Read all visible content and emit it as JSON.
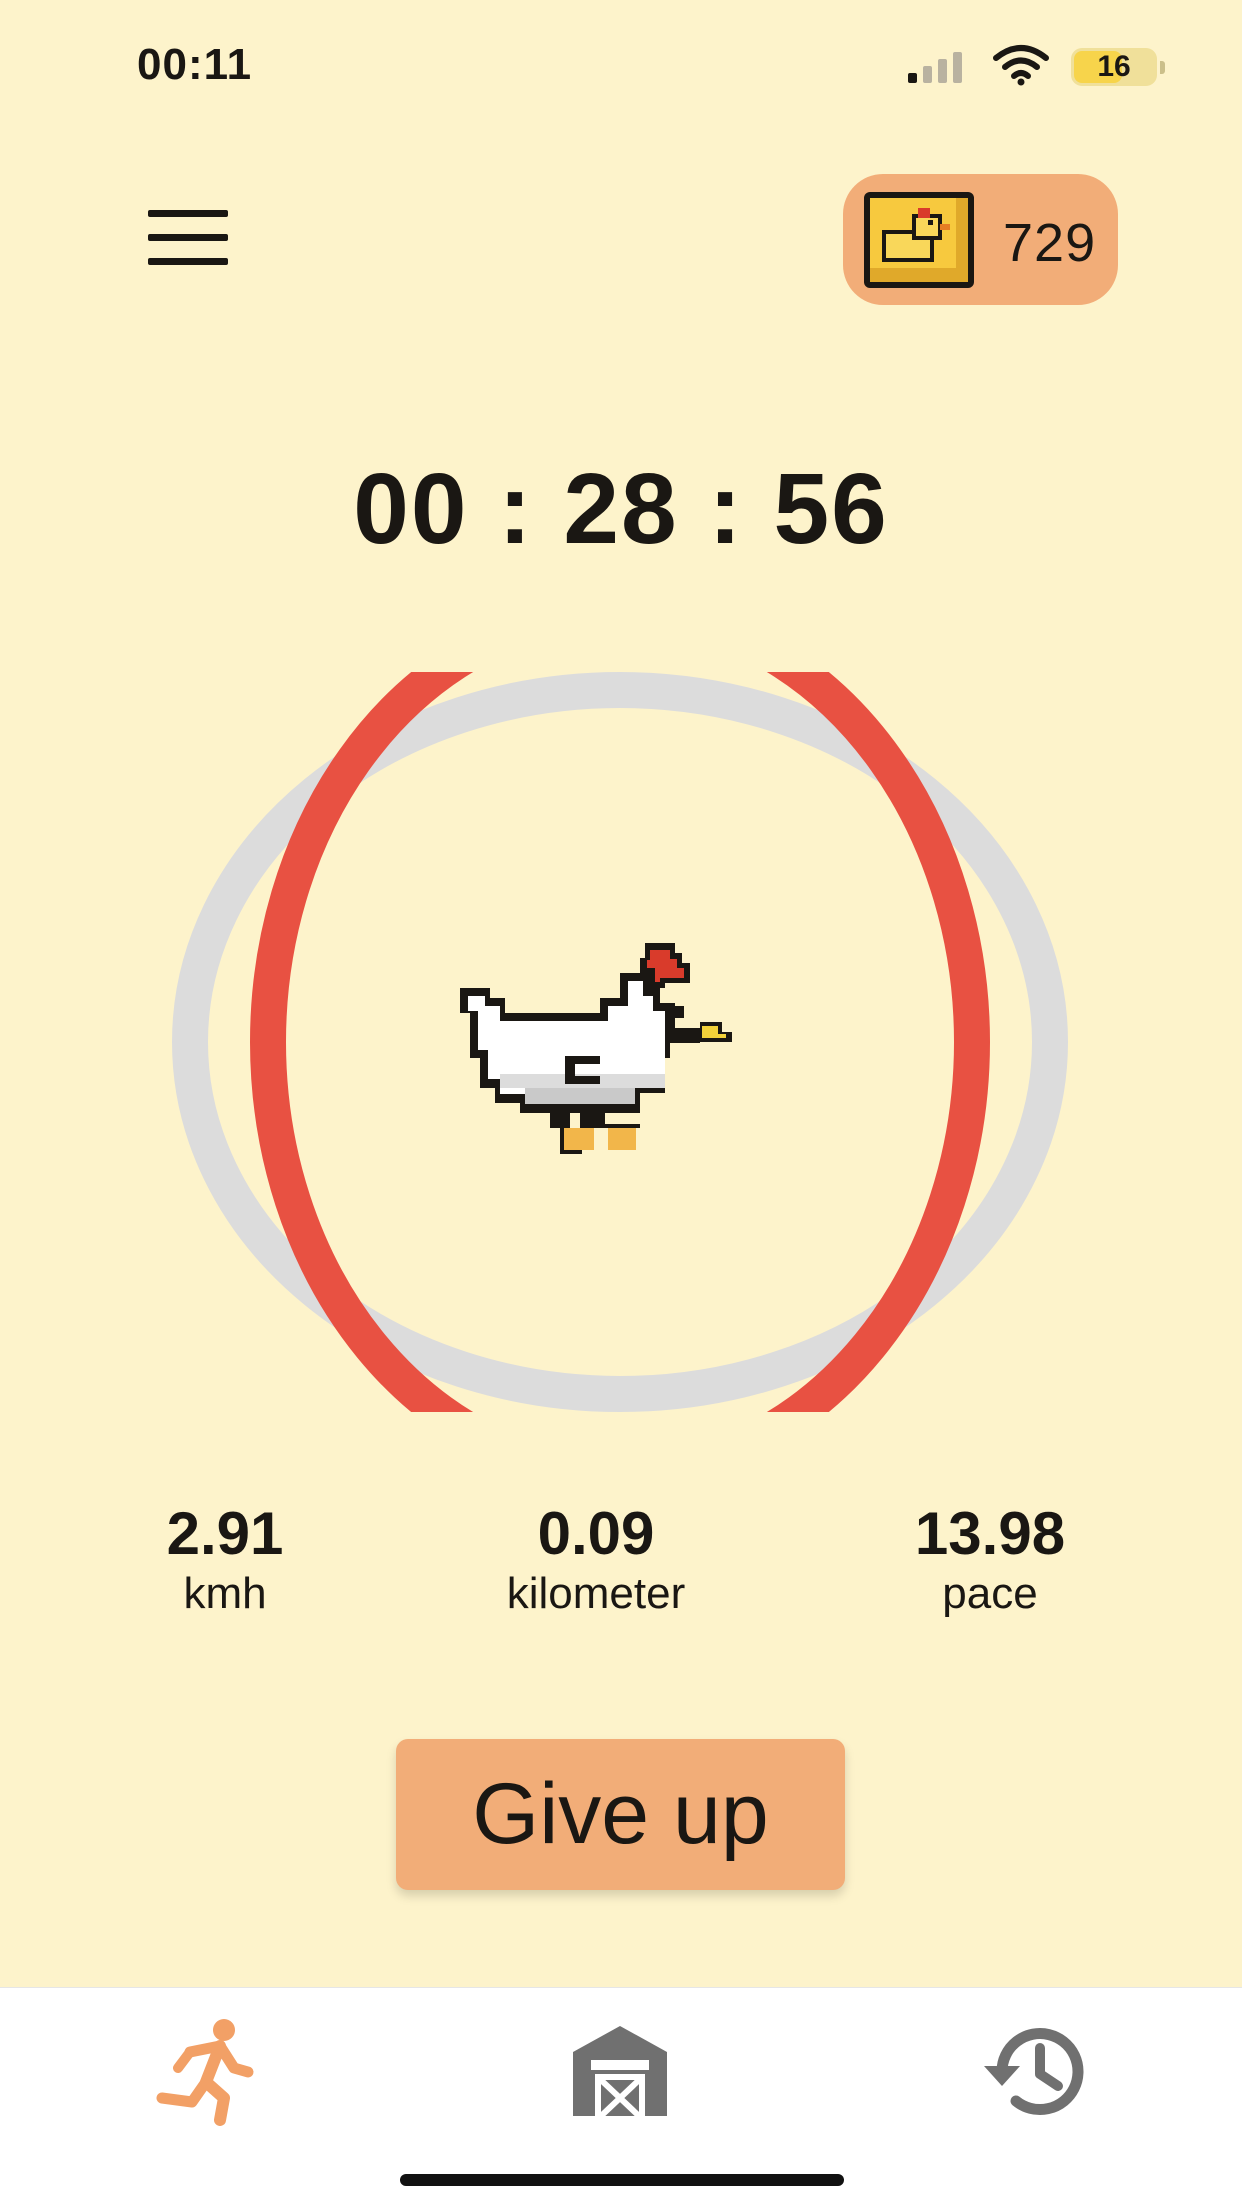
{
  "status_bar": {
    "time": "00:11",
    "battery_level": "16"
  },
  "coins": {
    "count": "729",
    "icon": "chicken-coin-icon"
  },
  "timer": {
    "display": "00 : 28 : 56"
  },
  "progress": {
    "fraction": 0.96
  },
  "stats": [
    {
      "value": "2.91",
      "label": "kmh"
    },
    {
      "value": "0.09",
      "label": "kilometer"
    },
    {
      "value": "13.98",
      "label": "pace"
    }
  ],
  "actions": {
    "give_up_label": "Give up"
  },
  "tabs": [
    {
      "icon": "running-icon",
      "active": true
    },
    {
      "icon": "barn-icon",
      "active": false
    },
    {
      "icon": "history-icon",
      "active": false
    }
  ],
  "colors": {
    "background": "#fdf3cb",
    "accent": "#f2ad78",
    "ring": "#e85142",
    "ring_track": "#dcdcdc",
    "active_tab": "#f2a066",
    "inactive_tab": "#707070"
  }
}
